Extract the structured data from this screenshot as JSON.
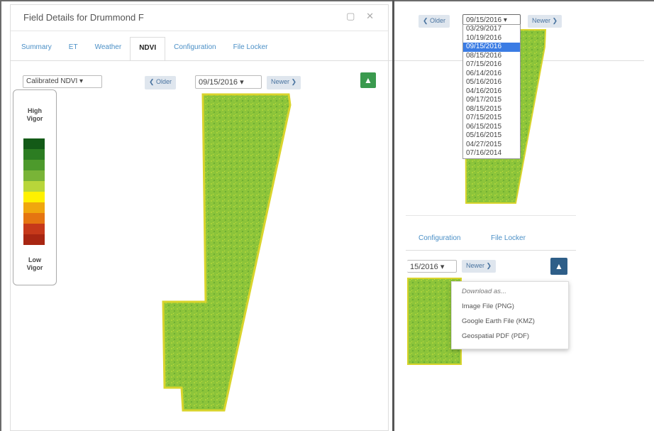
{
  "panel": {
    "title": "Field Details for Drummond F",
    "window_icons": [
      "restore-icon",
      "close-icon"
    ],
    "close_glyph": "✕",
    "restore_glyph": "▢"
  },
  "tabs": [
    {
      "label": "Summary",
      "active": false
    },
    {
      "label": "ET",
      "active": false
    },
    {
      "label": "Weather",
      "active": false
    },
    {
      "label": "NDVI",
      "active": true
    },
    {
      "label": "Configuration",
      "active": false
    },
    {
      "label": "File Locker",
      "active": false
    }
  ],
  "toolbar": {
    "layer_select": "Calibrated NDVI ▾",
    "older_label": "❮ Older",
    "date_select": "09/15/2016 ▾",
    "newer_label": "Newer ❯",
    "download_icon": "▲"
  },
  "legend": {
    "high_label_1": "High",
    "high_label_2": "Vigor",
    "low_label_1": "Low",
    "low_label_2": "Vigor",
    "colors": [
      "#135a17",
      "#2c7d22",
      "#4d9a2c",
      "#79b437",
      "#b8d63a",
      "#fff100",
      "#f0a70e",
      "#e57511",
      "#c6391a",
      "#a82612"
    ]
  },
  "right": {
    "older_label": "❮ Older",
    "date_select": "09/15/2016 ▾",
    "newer_label": "Newer ❯",
    "dates": [
      "03/29/2017",
      "10/19/2016",
      "09/15/2016",
      "08/15/2016",
      "07/15/2016",
      "06/14/2016",
      "05/16/2016",
      "04/16/2016",
      "09/17/2015",
      "08/15/2015",
      "07/15/2015",
      "06/15/2015",
      "05/16/2015",
      "04/27/2015",
      "07/16/2014"
    ],
    "selected_date": "09/15/2016",
    "tab_configuration": "Configuration",
    "tab_file_locker": "File Locker",
    "date_select_partial": "15/2016 ▾",
    "newer_label_2": "Newer ❯",
    "download_icon": "▲",
    "menu": {
      "header": "Download as...",
      "items": [
        "Image File (PNG)",
        "Google Earth File (KMZ)",
        "Geospatial PDF (PDF)"
      ]
    }
  }
}
